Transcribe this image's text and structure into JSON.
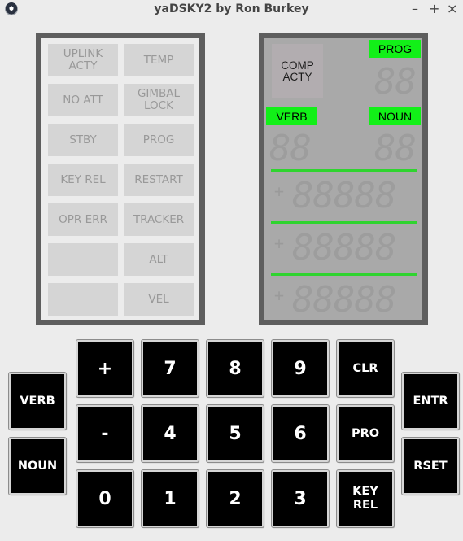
{
  "window": {
    "title": "yaDSKY2 by Ron Burkey",
    "min_glyph": "–",
    "max_glyph": "+",
    "close_glyph": "×"
  },
  "annunciators": [
    {
      "label": "UPLINK\nACTY"
    },
    {
      "label": "TEMP"
    },
    {
      "label": "NO ATT"
    },
    {
      "label": "GIMBAL\nLOCK"
    },
    {
      "label": "STBY"
    },
    {
      "label": "PROG"
    },
    {
      "label": "KEY REL"
    },
    {
      "label": "RESTART"
    },
    {
      "label": "OPR ERR"
    },
    {
      "label": "TRACKER"
    },
    {
      "label": ""
    },
    {
      "label": "ALT"
    },
    {
      "label": ""
    },
    {
      "label": "VEL"
    }
  ],
  "display": {
    "comp_acty": "COMP\nACTY",
    "prog_label": "PROG",
    "verb_label": "VERB",
    "noun_label": "NOUN",
    "prog_digits": "88",
    "verb_digits": "88",
    "noun_digits": "88",
    "reg_digits": "88888",
    "sign_ghost": "+",
    "lamp_color": "#12f018"
  },
  "keypad": {
    "verb": "VERB",
    "noun": "NOUN",
    "plus": "+",
    "minus": "-",
    "k0": "0",
    "k1": "1",
    "k2": "2",
    "k3": "3",
    "k4": "4",
    "k5": "5",
    "k6": "6",
    "k7": "7",
    "k8": "8",
    "k9": "9",
    "clr": "CLR",
    "pro": "PRO",
    "key_rel": "KEY\nREL",
    "entr": "ENTR",
    "rset": "RSET"
  }
}
